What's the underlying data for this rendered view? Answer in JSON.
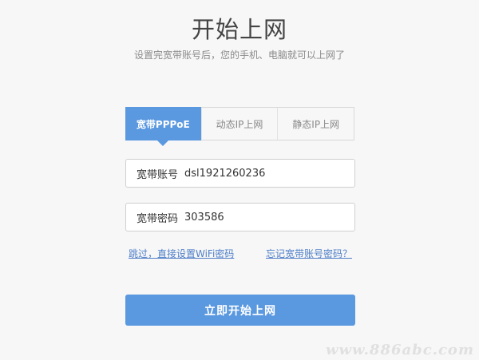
{
  "header": {
    "title": "开始上网",
    "subtitle": "设置完宽带账号后，您的手机、电脑就可以上网了"
  },
  "tabs": [
    {
      "label": "宽带PPPoE",
      "active": true
    },
    {
      "label": "动态IP上网",
      "active": false
    },
    {
      "label": "静态IP上网",
      "active": false
    }
  ],
  "form": {
    "account_label": "宽带账号",
    "account_value": "dsl1921260236",
    "password_label": "宽带密码",
    "password_value": "303586"
  },
  "links": {
    "skip": "跳过，直接设置WiFi密码",
    "forgot": "忘记宽带账号密码？"
  },
  "submit_label": "立即开始上网",
  "watermark": "www.886abc.com",
  "colors": {
    "accent": "#5a98e0",
    "link": "#4f7fc8",
    "background": "#f7f7f7"
  }
}
